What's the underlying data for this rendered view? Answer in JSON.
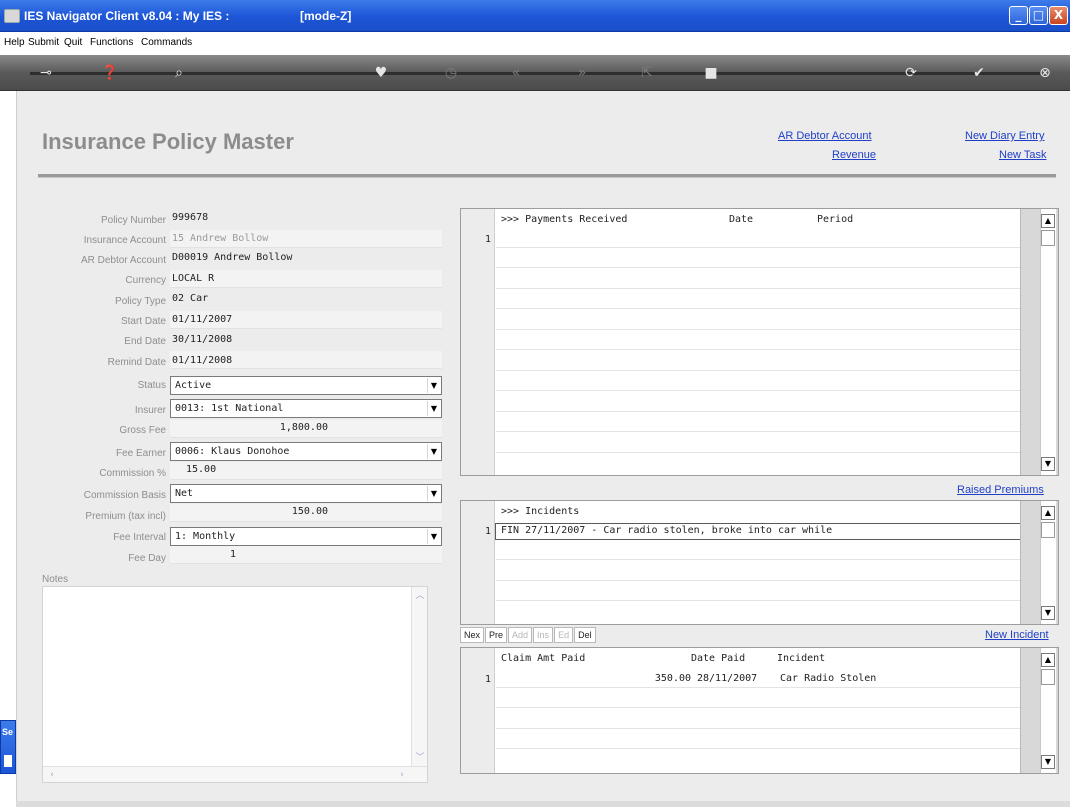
{
  "window": {
    "title": "IES Navigator Client v8.04 : My IES :",
    "mode": "[mode-Z]",
    "minimize_label": "_",
    "maximize_label": "□",
    "close_label": "X"
  },
  "menu": [
    "Help",
    "Submit",
    "Quit",
    "Functions",
    "Commands"
  ],
  "toolbar": {
    "icons": [
      "key-icon",
      "help-icon",
      "search-icon",
      "heart-icon",
      "clock-icon",
      "rewind-icon",
      "fast-forward-icon",
      "export-icon",
      "stop-icon",
      "refresh-icon",
      "check-icon",
      "close-icon"
    ]
  },
  "page": {
    "title": "Insurance Policy Master",
    "links": {
      "ar_debtor_account": "AR Debtor Account",
      "revenue": "Revenue",
      "new_diary_entry": "New Diary Entry",
      "new_task": "New Task",
      "raised_premiums": "Raised Premiums",
      "new_incident": "New Incident"
    }
  },
  "form": {
    "policy_number": {
      "label": "Policy Number",
      "value": "999678"
    },
    "insurance_account": {
      "label": "Insurance Account",
      "value": "15 Andrew Bollow"
    },
    "ar_debtor_account": {
      "label": "AR Debtor Account",
      "value": "D00019 Andrew Bollow"
    },
    "currency": {
      "label": "Currency",
      "value": "LOCAL R"
    },
    "policy_type": {
      "label": "Policy Type",
      "value": "02 Car"
    },
    "start_date": {
      "label": "Start Date",
      "value": "01/11/2007"
    },
    "end_date": {
      "label": "End Date",
      "value": "30/11/2008"
    },
    "remind_date": {
      "label": "Remind Date",
      "value": "01/11/2008"
    },
    "status": {
      "label": "Status",
      "value": "Active"
    },
    "insurer": {
      "label": "Insurer",
      "value": "0013: 1st National"
    },
    "gross_fee": {
      "label": "Gross Fee",
      "value": "1,800.00"
    },
    "fee_earner": {
      "label": "Fee Earner",
      "value": "0006: Klaus Donohoe"
    },
    "commission_pct": {
      "label": "Commission %",
      "value": "15.00"
    },
    "commission_basis": {
      "label": "Commission Basis",
      "value": "Net"
    },
    "premium": {
      "label": "Premium (tax incl)",
      "value": "150.00"
    },
    "fee_interval": {
      "label": "Fee Interval",
      "value": "1: Monthly"
    },
    "fee_day": {
      "label": "Fee Day",
      "value": "1"
    },
    "notes": {
      "label": "Notes",
      "value": ""
    }
  },
  "payments": {
    "headers": [
      ">>> Payments Received",
      "Date",
      "Period"
    ],
    "rows": [
      {
        "num": "1"
      }
    ]
  },
  "incidents": {
    "header": ">>> Incidents",
    "rows": [
      {
        "num": "1",
        "text": "FIN 27/11/2007 - Car radio stolen, broke into car while"
      }
    ],
    "toolbar": [
      "Nex",
      "Pre",
      "Add",
      "Ins",
      "Ed",
      "Del"
    ]
  },
  "claims": {
    "headers": [
      "Claim Amt Paid",
      "Date Paid",
      "Incident"
    ],
    "rows": [
      {
        "num": "1",
        "amount": "350.00",
        "date": "28/11/2007",
        "incident": "Car Radio Stolen"
      }
    ]
  },
  "side_tab": {
    "label": "Se"
  }
}
